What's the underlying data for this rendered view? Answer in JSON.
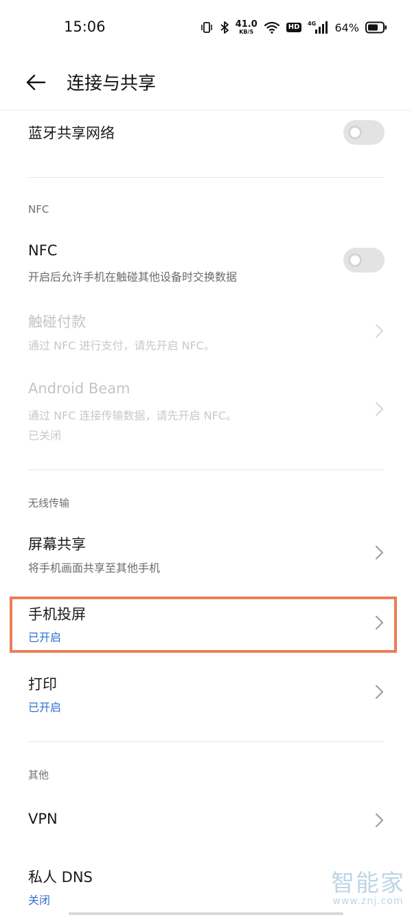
{
  "status_bar": {
    "time": "15:06",
    "net_speed_value": "41.0",
    "net_speed_unit": "KB/S",
    "hd_label": "HD",
    "network_type": "4G",
    "battery_percent": "64%",
    "icons": [
      "vibrate-icon",
      "bluetooth-icon",
      "wifi-icon",
      "signal-icon",
      "battery-icon"
    ]
  },
  "header": {
    "title": "连接与共享",
    "back_icon": "back-arrow-icon"
  },
  "sections": {
    "bluetooth_tethering": {
      "title": "蓝牙共享网络",
      "toggle_on": false
    },
    "nfc_section": {
      "label": "NFC",
      "nfc": {
        "title": "NFC",
        "subtitle": "开启后允许手机在触碰其他设备时交换数据",
        "toggle_on": false
      },
      "tap_pay": {
        "title": "触碰付款",
        "subtitle": "通过 NFC 进行支付，请先开启 NFC。"
      },
      "android_beam": {
        "title": "Android Beam",
        "subtitle": "通过 NFC 连接传输数据，请先开启 NFC。",
        "status": "已关闭"
      }
    },
    "wireless_section": {
      "label": "无线传输",
      "screen_share": {
        "title": "屏幕共享",
        "subtitle": "将手机画面共享至其他手机"
      },
      "screen_cast": {
        "title": "手机投屏",
        "status": "已开启"
      },
      "print": {
        "title": "打印",
        "status": "已开启"
      }
    },
    "other_section": {
      "label": "其他",
      "vpn": {
        "title": "VPN"
      },
      "private_dns": {
        "title": "私人 DNS",
        "status": "关闭"
      }
    }
  },
  "colors": {
    "accent_blue": "#2f6fd0",
    "highlight_orange": "#ec7e56",
    "toggle_off": "#e3e3e3",
    "disabled_text": "#c4c4c4"
  },
  "watermark": {
    "main": "智能家",
    "sub": "www.znj.com"
  }
}
